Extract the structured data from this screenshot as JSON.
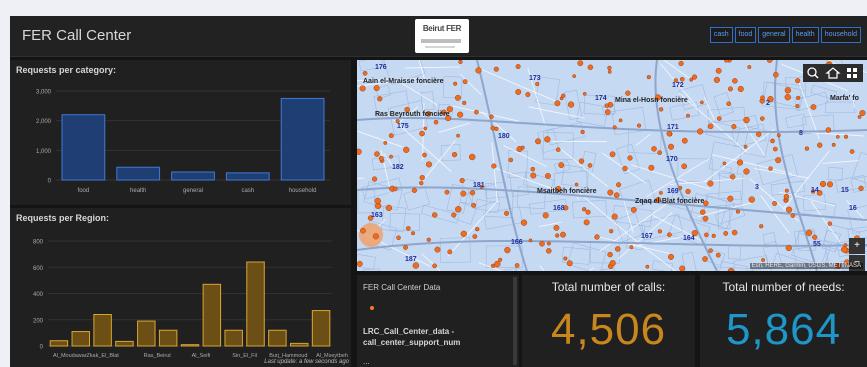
{
  "header": {
    "title": "FER Call Center",
    "logo_text": "Beirut FER",
    "filters": [
      "cash",
      "food",
      "general",
      "health",
      "household"
    ]
  },
  "category_chart": {
    "title": "Requests per category:",
    "chart_data": {
      "type": "bar",
      "categories": [
        "food",
        "health",
        "general",
        "cash",
        "household"
      ],
      "values": [
        2200,
        430,
        270,
        240,
        2750
      ],
      "ylim": [
        0,
        3000
      ],
      "yticks": [
        "0",
        "1,000",
        "2,000",
        "3,000"
      ],
      "ytick_values": [
        0,
        1000,
        2000,
        3000
      ],
      "grid": true,
      "colors": {
        "bar_fill": "#1f3f74",
        "bar_stroke": "#3f7ad6"
      }
    }
  },
  "region_chart": {
    "title": "Requests per Region:",
    "last_update": "Last update: a few seconds ago",
    "chart_data": {
      "type": "bar",
      "categories": [
        "Al_Moudawar",
        "Zkak_El_Blat",
        "",
        "Ras_Beirut",
        "",
        "Al_Seifi",
        "",
        "Sin_El_Fil",
        "Burj_Hammoud",
        "",
        "Al_Mseytbeh"
      ],
      "values": [
        40,
        110,
        240,
        35,
        190,
        120,
        10,
        470,
        120,
        640,
        120,
        20,
        270
      ],
      "xtick_labels": [
        "Al_Moudawar",
        "Zkak_El_Blat",
        "Ras_Beirut",
        "Al_Seifi",
        "Sin_El_Fil",
        "Burj_Hammoud",
        "Al_Mseytbeh"
      ],
      "xtick_bar_index": [
        0.5,
        2,
        4.5,
        6.5,
        8.5,
        10.5,
        12.5
      ],
      "ylim": [
        0,
        800
      ],
      "yticks": [
        "0",
        "200",
        "400",
        "600",
        "800"
      ],
      "ytick_values": [
        0,
        200,
        400,
        600,
        800
      ],
      "grid": true,
      "colors": {
        "bar_fill": "#6b4f14",
        "bar_stroke": "#d9a532"
      }
    }
  },
  "map": {
    "attribution": "Esri, HERE, Garmin, USGS, METI/NASA",
    "labels": [
      "Aain el-Mraisse foncière",
      "Mina el-Hosn foncière",
      "Marfa' fo",
      "Ras Beyrouth foncière",
      "Msaitbeh foncière",
      "Zqaq el-Blat foncière"
    ],
    "numbers": [
      "176",
      "173",
      "172",
      "174",
      "175",
      "180",
      "171",
      "2",
      "8",
      "182",
      "181",
      "170",
      "169",
      "168",
      "163",
      "167",
      "166",
      "164",
      "187",
      "14",
      "15",
      "16",
      "3",
      "55"
    ],
    "zoom_in": "+",
    "zoom_out": "−",
    "colors": {
      "water": "#c6d9f3",
      "road": "#ffffff",
      "point": "#ef6c1e"
    }
  },
  "data_panel": {
    "title": "FER Call Center Data",
    "field": "LRC_Call_Center_data - call_center_support_num",
    "more": "..."
  },
  "calls": {
    "title": "Total number of calls:",
    "value": "4,506",
    "color": "#c8861d"
  },
  "needs": {
    "title": "Total number of needs:",
    "value": "5,864",
    "color": "#1e96c8"
  }
}
